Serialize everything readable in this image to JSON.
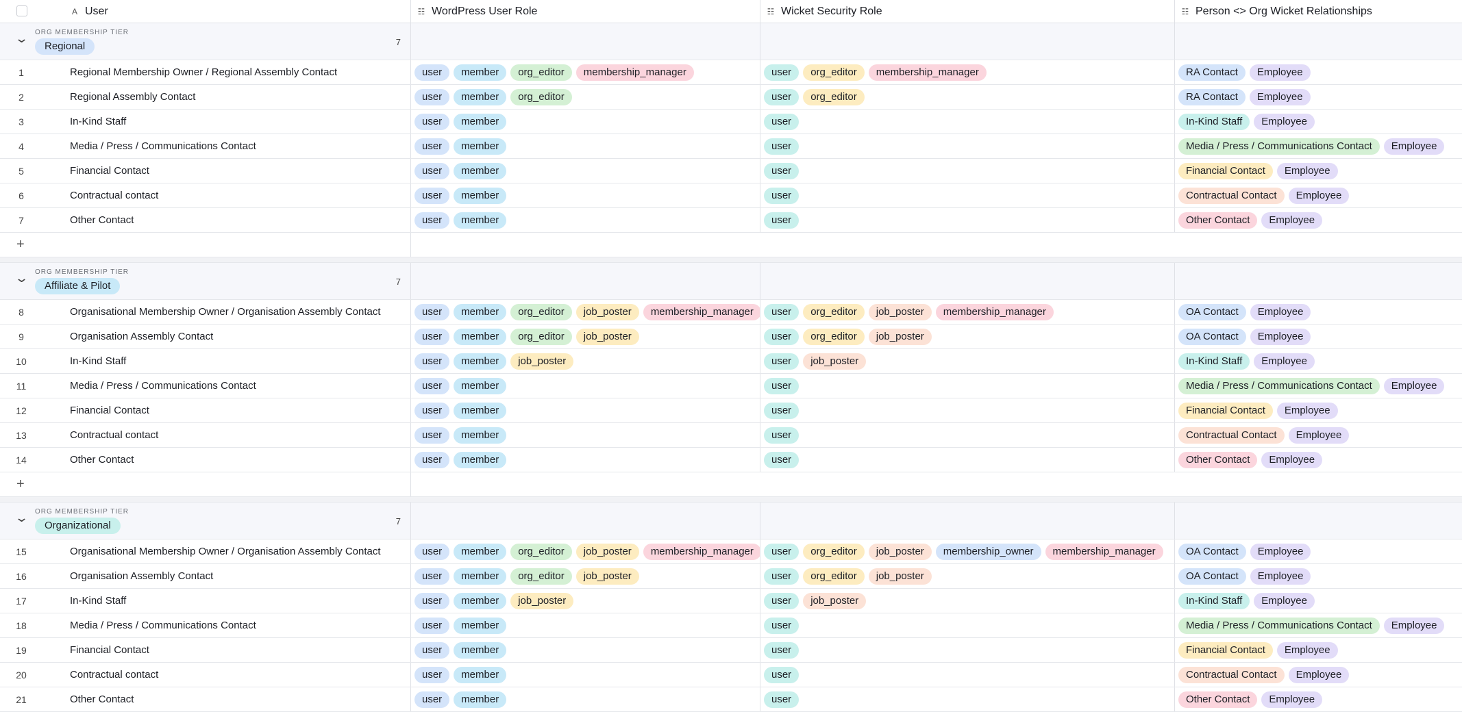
{
  "columns": [
    {
      "label": "User",
      "icon": "sort-az-icon"
    },
    {
      "label": "WordPress User Role",
      "icon": "list-icon"
    },
    {
      "label": "Wicket Security Role",
      "icon": "list-icon"
    },
    {
      "label": "Person <> Org Wicket Relationships",
      "icon": "list-icon"
    }
  ],
  "tag_colors": {
    "user": "#d4e4fa",
    "member": "#c8e9f8",
    "org_editor": "#d4f0d4",
    "membership_manager": "#fbd5dd",
    "job_poster": "#fdecc0",
    "membership_owner": "#d4e4fa",
    "sec_user": "#c8f0ec",
    "sec_org_editor": "#fdecc0",
    "sec_membership_manager": "#fbd5dd",
    "sec_job_poster": "#fce2d6",
    "sec_membership_owner": "#d4e4fa",
    "RA Contact": "#d4e4fa",
    "OA Contact": "#d4e4fa",
    "Employee": "#e2dcf8",
    "In-Kind Staff": "#c8f0ec",
    "Media / Press / Communications Contact": "#d4f0d4",
    "Financial Contact": "#fdecc0",
    "Contractual Contact": "#fce2d6",
    "Other Contact": "#fbd5dd"
  },
  "groups": [
    {
      "tier_label": "ORG MEMBERSHIP TIER",
      "tier": "Regional",
      "tier_color": "#d4e4fa",
      "count": "7",
      "rows": [
        {
          "n": "1",
          "user": "Regional Membership Owner / Regional Assembly Contact",
          "wp": [
            "user",
            "member",
            "org_editor",
            "membership_manager"
          ],
          "sec": [
            "user",
            "org_editor",
            "membership_manager"
          ],
          "rel": [
            "RA Contact",
            "Employee"
          ]
        },
        {
          "n": "2",
          "user": "Regional Assembly Contact",
          "wp": [
            "user",
            "member",
            "org_editor"
          ],
          "sec": [
            "user",
            "org_editor"
          ],
          "rel": [
            "RA Contact",
            "Employee"
          ]
        },
        {
          "n": "3",
          "user": "In-Kind Staff",
          "wp": [
            "user",
            "member"
          ],
          "sec": [
            "user"
          ],
          "rel": [
            "In-Kind Staff",
            "Employee"
          ]
        },
        {
          "n": "4",
          "user": "Media / Press / Communications Contact",
          "wp": [
            "user",
            "member"
          ],
          "sec": [
            "user"
          ],
          "rel": [
            "Media / Press / Communications Contact",
            "Employee"
          ]
        },
        {
          "n": "5",
          "user": "Financial Contact",
          "wp": [
            "user",
            "member"
          ],
          "sec": [
            "user"
          ],
          "rel": [
            "Financial Contact",
            "Employee"
          ]
        },
        {
          "n": "6",
          "user": "Contractual contact",
          "wp": [
            "user",
            "member"
          ],
          "sec": [
            "user"
          ],
          "rel": [
            "Contractual Contact",
            "Employee"
          ]
        },
        {
          "n": "7",
          "user": "Other Contact",
          "wp": [
            "user",
            "member"
          ],
          "sec": [
            "user"
          ],
          "rel": [
            "Other Contact",
            "Employee"
          ]
        }
      ]
    },
    {
      "tier_label": "ORG MEMBERSHIP TIER",
      "tier": "Affiliate & Pilot",
      "tier_color": "#c8e9f8",
      "count": "7",
      "rows": [
        {
          "n": "8",
          "user": "Organisational Membership Owner / Organisation Assembly Contact",
          "wp": [
            "user",
            "member",
            "org_editor",
            "job_poster",
            "membership_manager"
          ],
          "sec": [
            "user",
            "org_editor",
            "job_poster",
            "membership_manager"
          ],
          "rel": [
            "OA Contact",
            "Employee"
          ]
        },
        {
          "n": "9",
          "user": "Organisation Assembly Contact",
          "wp": [
            "user",
            "member",
            "org_editor",
            "job_poster"
          ],
          "sec": [
            "user",
            "org_editor",
            "job_poster"
          ],
          "rel": [
            "OA Contact",
            "Employee"
          ]
        },
        {
          "n": "10",
          "user": "In-Kind Staff",
          "wp": [
            "user",
            "member",
            "job_poster"
          ],
          "sec": [
            "user",
            "job_poster"
          ],
          "rel": [
            "In-Kind Staff",
            "Employee"
          ]
        },
        {
          "n": "11",
          "user": "Media / Press / Communications Contact",
          "wp": [
            "user",
            "member"
          ],
          "sec": [
            "user"
          ],
          "rel": [
            "Media / Press / Communications Contact",
            "Employee"
          ]
        },
        {
          "n": "12",
          "user": "Financial Contact",
          "wp": [
            "user",
            "member"
          ],
          "sec": [
            "user"
          ],
          "rel": [
            "Financial Contact",
            "Employee"
          ]
        },
        {
          "n": "13",
          "user": "Contractual contact",
          "wp": [
            "user",
            "member"
          ],
          "sec": [
            "user"
          ],
          "rel": [
            "Contractual Contact",
            "Employee"
          ]
        },
        {
          "n": "14",
          "user": "Other Contact",
          "wp": [
            "user",
            "member"
          ],
          "sec": [
            "user"
          ],
          "rel": [
            "Other Contact",
            "Employee"
          ]
        }
      ]
    },
    {
      "tier_label": "ORG MEMBERSHIP TIER",
      "tier": "Organizational",
      "tier_color": "#c8f0ec",
      "count": "7",
      "rows": [
        {
          "n": "15",
          "user": "Organisational Membership Owner / Organisation Assembly Contact",
          "wp": [
            "user",
            "member",
            "org_editor",
            "job_poster",
            "membership_manager"
          ],
          "sec": [
            "user",
            "org_editor",
            "job_poster",
            "membership_owner",
            "membership_manager"
          ],
          "rel": [
            "OA Contact",
            "Employee"
          ]
        },
        {
          "n": "16",
          "user": "Organisation Assembly Contact",
          "wp": [
            "user",
            "member",
            "org_editor",
            "job_poster"
          ],
          "sec": [
            "user",
            "org_editor",
            "job_poster"
          ],
          "rel": [
            "OA Contact",
            "Employee"
          ]
        },
        {
          "n": "17",
          "user": "In-Kind Staff",
          "wp": [
            "user",
            "member",
            "job_poster"
          ],
          "sec": [
            "user",
            "job_poster"
          ],
          "rel": [
            "In-Kind Staff",
            "Employee"
          ]
        },
        {
          "n": "18",
          "user": "Media / Press / Communications Contact",
          "wp": [
            "user",
            "member"
          ],
          "sec": [
            "user"
          ],
          "rel": [
            "Media / Press / Communications Contact",
            "Employee"
          ]
        },
        {
          "n": "19",
          "user": "Financial Contact",
          "wp": [
            "user",
            "member"
          ],
          "sec": [
            "user"
          ],
          "rel": [
            "Financial Contact",
            "Employee"
          ]
        },
        {
          "n": "20",
          "user": "Contractual contact",
          "wp": [
            "user",
            "member"
          ],
          "sec": [
            "user"
          ],
          "rel": [
            "Contractual Contact",
            "Employee"
          ]
        },
        {
          "n": "21",
          "user": "Other Contact",
          "wp": [
            "user",
            "member"
          ],
          "sec": [
            "user"
          ],
          "rel": [
            "Other Contact",
            "Employee"
          ]
        }
      ]
    }
  ],
  "add_row_symbol": "+"
}
